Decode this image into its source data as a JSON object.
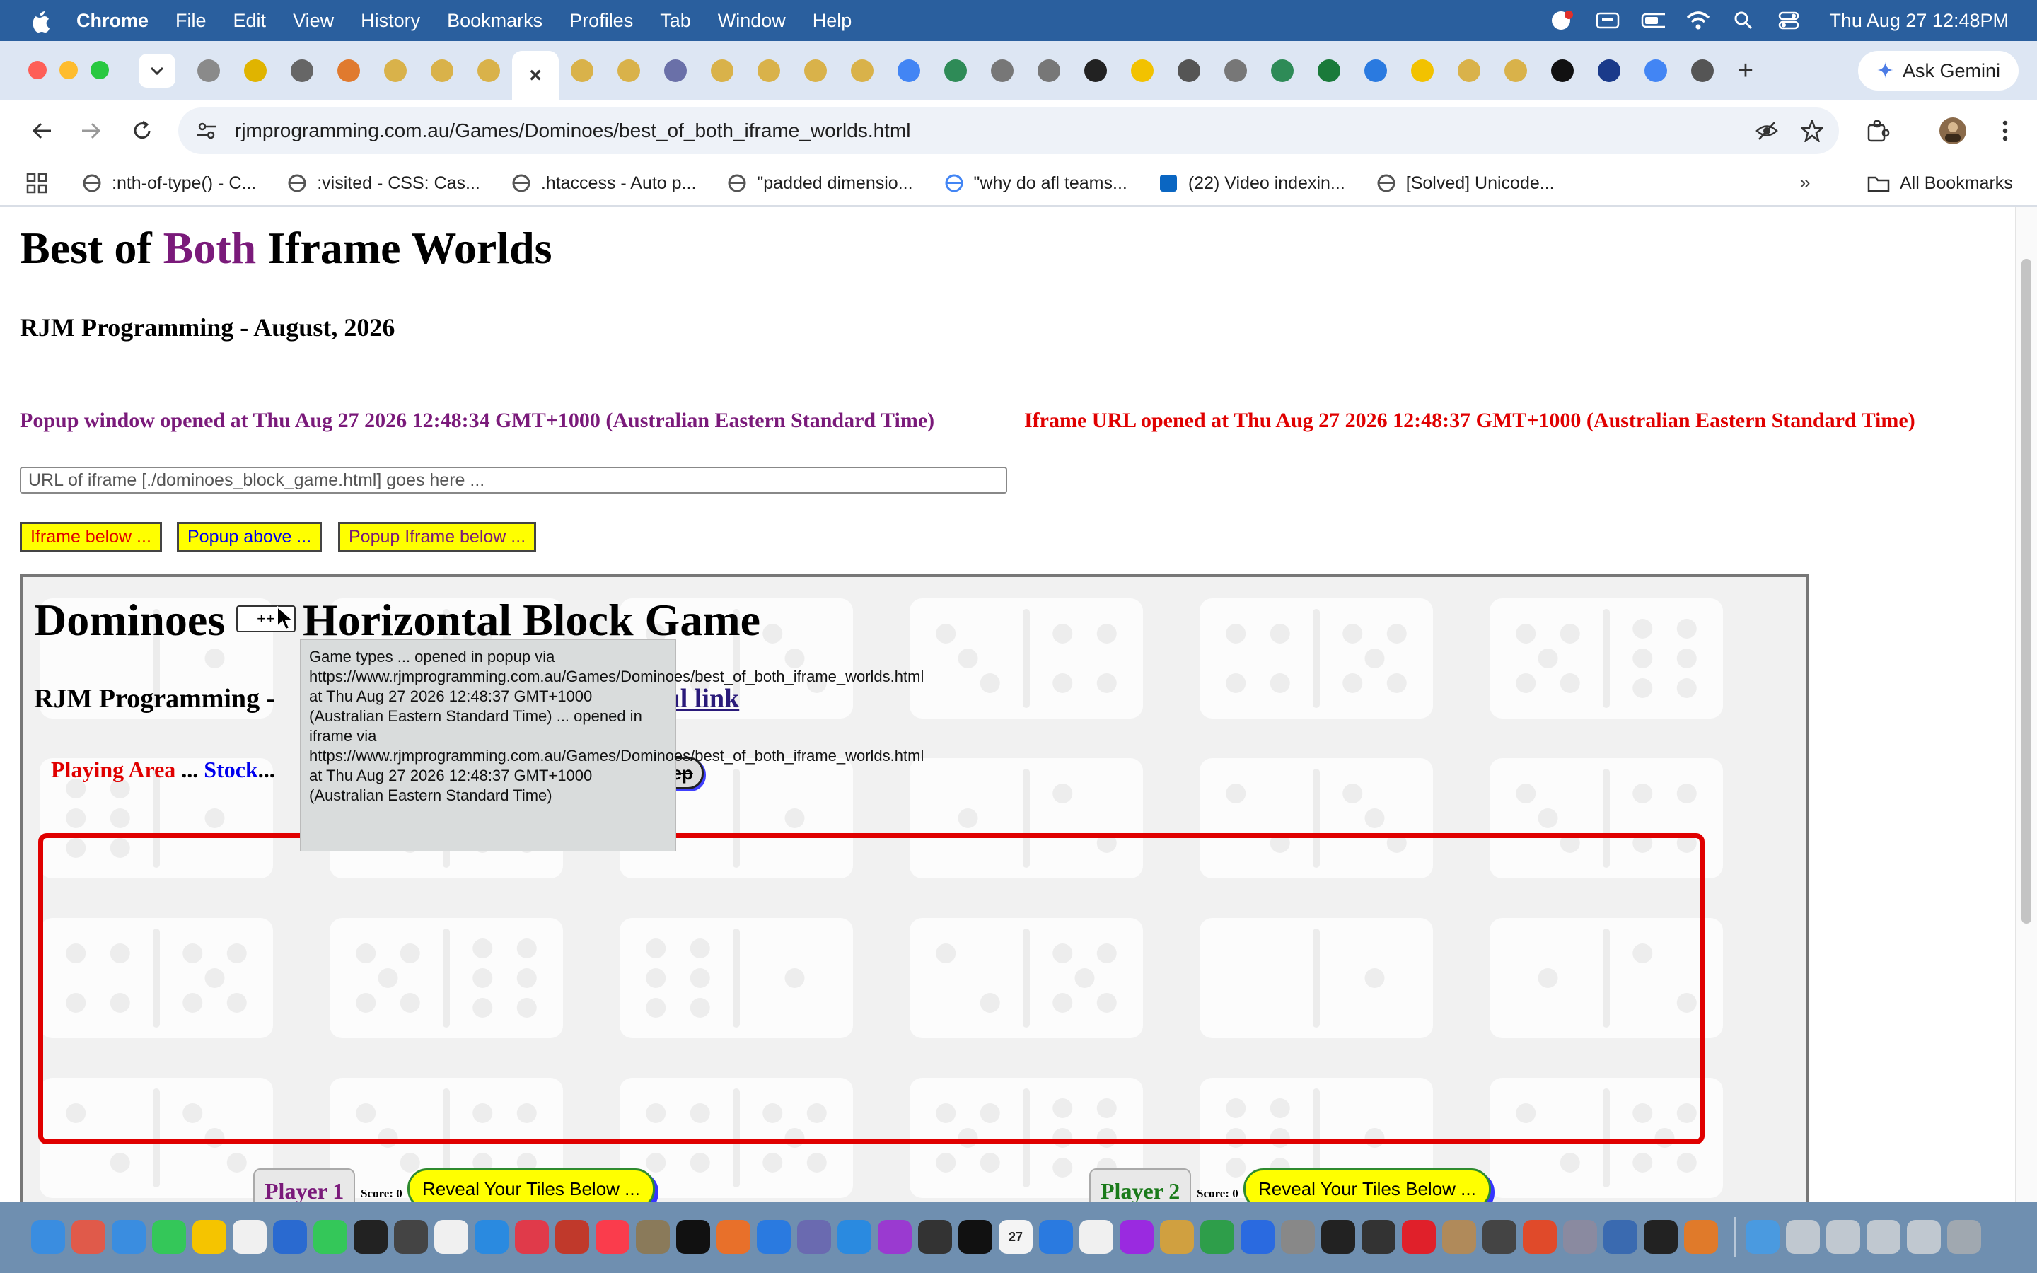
{
  "menubar": {
    "app": "Chrome",
    "menus": [
      "File",
      "Edit",
      "View",
      "History",
      "Bookmarks",
      "Profiles",
      "Tab",
      "Window",
      "Help"
    ],
    "clock": "Thu Aug 27  12:48PM"
  },
  "browser": {
    "ask_gemini": "Ask Gemini",
    "url": "rjmprogramming.com.au/Games/Dominoes/best_of_both_iframe_worlds.html",
    "tab_favicons": [
      {
        "icon": "circle-icon",
        "color": "#8a8a8a"
      },
      {
        "icon": "check-icon",
        "color": "#e0b400"
      },
      {
        "icon": "chrome-icon",
        "color": "#666666"
      },
      {
        "icon": "square-icon",
        "color": "#e07a2e"
      },
      {
        "icon": "rocket-icon",
        "color": "#d9b24a"
      },
      {
        "icon": "rocket-icon",
        "color": "#d9b24a"
      },
      {
        "icon": "rocket-icon",
        "color": "#d9b24a"
      },
      {
        "icon": "close-icon",
        "color": "#333333"
      },
      {
        "icon": "rocket-icon",
        "color": "#d9b24a"
      },
      {
        "icon": "rocket-icon",
        "color": "#d9b24a"
      },
      {
        "icon": "php-icon",
        "color": "#6a70a8"
      },
      {
        "icon": "rocket-icon",
        "color": "#d9b24a"
      },
      {
        "icon": "rocket-icon",
        "color": "#d9b24a"
      },
      {
        "icon": "rocket-icon",
        "color": "#d9b24a"
      },
      {
        "icon": "rocket-icon",
        "color": "#d9b24a"
      },
      {
        "icon": "google-icon",
        "color": "#4285f4"
      },
      {
        "icon": "w-icon",
        "color": "#2e8b57"
      },
      {
        "icon": "wikipedia-icon",
        "color": "#777777"
      },
      {
        "icon": "wikipedia-icon",
        "color": "#777777"
      },
      {
        "icon": "s-icon",
        "color": "#222222"
      },
      {
        "icon": "bolt-icon",
        "color": "#f2c200"
      },
      {
        "icon": "ghost-icon",
        "color": "#555555"
      },
      {
        "icon": "wikipedia-icon",
        "color": "#777777"
      },
      {
        "icon": "globe-icon",
        "color": "#2e8b57"
      },
      {
        "icon": "k-icon",
        "color": "#1a7a3a"
      },
      {
        "icon": "circle-icon",
        "color": "#2a7ae0"
      },
      {
        "icon": "bolt-icon",
        "color": "#f2c200"
      },
      {
        "icon": "rocket-icon",
        "color": "#d9b24a"
      },
      {
        "icon": "rocket-icon",
        "color": "#d9b24a"
      },
      {
        "icon": "s-icon",
        "color": "#111111"
      },
      {
        "icon": "afl-icon",
        "color": "#1a3a8a"
      },
      {
        "icon": "google-icon",
        "color": "#4285f4"
      },
      {
        "icon": "ghost-icon",
        "color": "#555555"
      }
    ],
    "bookmarks": [
      {
        "label": ":nth-of-type() - C...",
        "icon": "globe-icon"
      },
      {
        "label": ":visited - CSS: Cas...",
        "icon": "globe-icon"
      },
      {
        "label": ".htaccess - Auto p...",
        "icon": "globe-icon"
      },
      {
        "label": "\"padded dimensio...",
        "icon": "globe-icon"
      },
      {
        "label": "\"why do afl teams...",
        "icon": "google-icon"
      },
      {
        "label": "(22) Video indexin...",
        "icon": "linkedin-icon"
      },
      {
        "label": "[Solved] Unicode...",
        "icon": "globe-icon"
      }
    ],
    "all_bookmarks": "All Bookmarks",
    "more": "»"
  },
  "page": {
    "title_part1": "Best of ",
    "title_part2": "Both",
    "title_part3": " Iframe Worlds",
    "byline": "RJM Programming - August, 2026",
    "popup_stamp": "Popup window opened at Thu Aug 27 2026 12:48:34 GMT+1000 (Australian Eastern Standard Time)",
    "iframe_stamp": "Iframe URL opened at Thu Aug 27 2026 12:48:37 GMT+1000 (Australian Eastern Standard Time)",
    "url_placeholder": "URL of iframe [./dominoes_block_game.html] goes here ...",
    "buttons": {
      "iframe_below": "Iframe below ...",
      "popup_above": "Popup above ...",
      "popup_iframe_below": "Popup Iframe below ..."
    },
    "colors": {
      "purple": "#7a1a7a",
      "red": "#e00000",
      "blue": "#0000ee",
      "yellow": "#ffff00"
    }
  },
  "iframe": {
    "title_a": "Dominoes",
    "select_value": "++",
    "title_b": "Horizontal Block Game",
    "byline": "RJM Programming - ",
    "useful_link": "ful link",
    "legend_play": "Playing Area",
    "legend_dots1": " ... ",
    "legend_stock": "Stock",
    "legend_dots2": "...",
    "sleep": "eep",
    "player1": "Player 1",
    "player2": "Player 2",
    "score1": "Score: 0",
    "score2": "Score: 0",
    "reveal1": "Reveal Your Tiles Below ...",
    "reveal2": "Reveal Your Tiles Below ...",
    "tooltip": "Game types ... opened in popup via https://www.rjmprogramming.com.au/Games/Dominoes/best_of_both_iframe_worlds.html at Thu Aug 27 2026 12:48:37 GMT+1000 (Australian Eastern Standard Time) ... opened in iframe via https://www.rjmprogramming.com.au/Games/Dominoes/best_of_both_iframe_worlds.html at Thu Aug 27 2026 12:48:37 GMT+1000 (Australian Eastern Standard Time)"
  },
  "dock": {
    "apps": [
      {
        "icon": "finder-icon",
        "color": "#3a8de0"
      },
      {
        "icon": "launchpad-icon",
        "color": "#e05a4a"
      },
      {
        "icon": "mail-icon",
        "color": "#3a8de0"
      },
      {
        "icon": "messages-icon",
        "color": "#34c759"
      },
      {
        "icon": "notes-icon",
        "color": "#f5c400"
      },
      {
        "icon": "reminders-icon",
        "color": "#f0f0f0"
      },
      {
        "icon": "freeform-icon",
        "color": "#2a6ad0"
      },
      {
        "icon": "facetime-icon",
        "color": "#34c759"
      },
      {
        "icon": "terminal-icon",
        "color": "#222222"
      },
      {
        "icon": "calculator-icon",
        "color": "#444444"
      },
      {
        "icon": "textedit-icon",
        "color": "#f0f0f0"
      },
      {
        "icon": "appstore-icon",
        "color": "#2a8ae0"
      },
      {
        "icon": "news-icon",
        "color": "#e03a4a"
      },
      {
        "icon": "filezilla-icon",
        "color": "#c0392b"
      },
      {
        "icon": "music-icon",
        "color": "#fa3c4c"
      },
      {
        "icon": "gimp-icon",
        "color": "#8a7a5a"
      },
      {
        "icon": "tv-icon",
        "color": "#111111"
      },
      {
        "icon": "firefox-icon",
        "color": "#e8702a"
      },
      {
        "icon": "xcode-icon",
        "color": "#2a7ae0"
      },
      {
        "icon": "bbedit-icon",
        "color": "#6a6ab0"
      },
      {
        "icon": "safari-icon",
        "color": "#2a8ae0"
      },
      {
        "icon": "podcasts-icon",
        "color": "#9a3ad0"
      },
      {
        "icon": "console-icon",
        "color": "#333333"
      },
      {
        "icon": "terminal-icon",
        "color": "#111111"
      },
      {
        "icon": "calendar-icon",
        "color": "#f4f4f4"
      },
      {
        "icon": "quicktime-icon",
        "color": "#2a7ae0"
      },
      {
        "icon": "preview-icon",
        "color": "#f0f0f0"
      },
      {
        "icon": "app-icon",
        "color": "#9a2ae0"
      },
      {
        "icon": "app-icon",
        "color": "#d0a040"
      },
      {
        "icon": "chrome-icon",
        "color": "#2e9e4a"
      },
      {
        "icon": "zoom-icon",
        "color": "#2a6ae0"
      },
      {
        "icon": "settings-icon",
        "color": "#888888"
      },
      {
        "icon": "app-icon",
        "color": "#222222"
      },
      {
        "icon": "app-icon",
        "color": "#333333"
      },
      {
        "icon": "opera-icon",
        "color": "#e0202a"
      },
      {
        "icon": "contacts-icon",
        "color": "#b08a5a"
      },
      {
        "icon": "app-icon",
        "color": "#444444"
      },
      {
        "icon": "app-icon",
        "color": "#e04a2a"
      },
      {
        "icon": "app-icon",
        "color": "#8a8aa0"
      },
      {
        "icon": "app-icon",
        "color": "#3a6ab0"
      },
      {
        "icon": "app-icon",
        "color": "#222222"
      },
      {
        "icon": "photos-icon",
        "color": "#e07a2a"
      },
      {
        "icon": "folder-icon",
        "color": "#4a9ae0"
      },
      {
        "icon": "window-icon",
        "color": "#c0c8d0"
      },
      {
        "icon": "window-icon",
        "color": "#c0c8d0"
      },
      {
        "icon": "window-icon",
        "color": "#c0c8d0"
      },
      {
        "icon": "window-icon",
        "color": "#c0c8d0"
      },
      {
        "icon": "trash-icon",
        "color": "#a0a8b0"
      }
    ],
    "calendar_day": "27"
  }
}
